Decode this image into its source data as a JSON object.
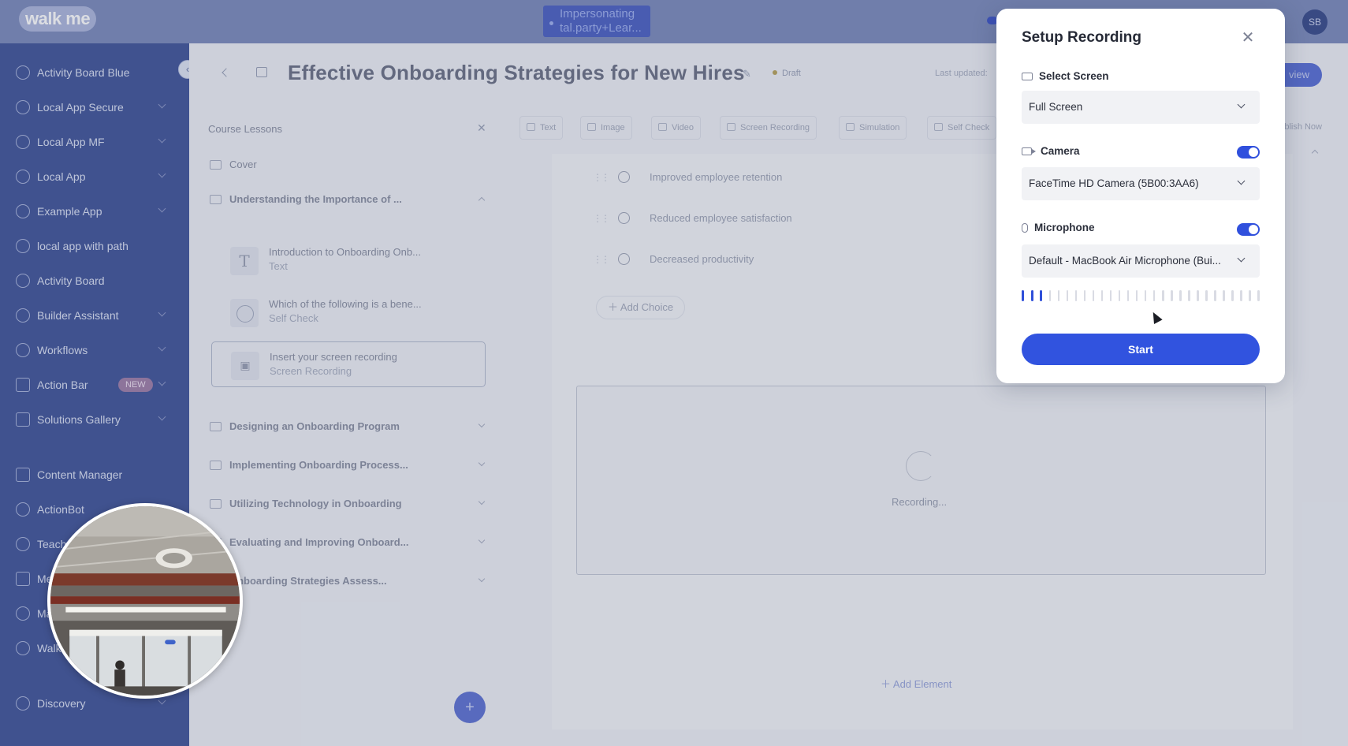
{
  "app": {
    "logo_text": "walk me",
    "impersonation": "Impersonating tal.party+Lear...",
    "user_initials": "SB"
  },
  "sidebar": {
    "items": [
      {
        "label": "Activity Board Blue",
        "chevron": false
      },
      {
        "label": "Local App Secure",
        "chevron": true
      },
      {
        "label": "Local App MF",
        "chevron": true
      },
      {
        "label": "Local App",
        "chevron": true
      },
      {
        "label": "Example App",
        "chevron": true
      },
      {
        "label": "local app with path",
        "chevron": false
      },
      {
        "label": "Activity Board",
        "chevron": false
      },
      {
        "label": "Builder Assistant",
        "chevron": true
      },
      {
        "label": "Workflows",
        "chevron": true
      },
      {
        "label": "Action Bar",
        "chevron": true,
        "badge": "NEW"
      },
      {
        "label": "Solutions Gallery",
        "chevron": true
      },
      {
        "label": "Content Manager",
        "chevron": false
      },
      {
        "label": "ActionBot",
        "chevron": false
      },
      {
        "label": "Teach",
        "chevron": false
      },
      {
        "label": "Me",
        "chevron": false
      },
      {
        "label": "Ma",
        "chevron": false
      },
      {
        "label": "Walk",
        "chevron": false
      },
      {
        "label": "Discovery",
        "chevron": true
      }
    ]
  },
  "header": {
    "title": "Effective Onboarding Strategies for New Hires",
    "status": "Draft",
    "last_updated": "Last updated:",
    "preview_label": "view"
  },
  "lessons": {
    "panel_title": "Course Lessons",
    "cover": "Cover",
    "sections": [
      "Understanding the Importance of ...",
      "Designing an Onboarding Program",
      "Implementing Onboarding Process...",
      "Utilizing Technology in Onboarding",
      "Evaluating and Improving Onboard...",
      "Onboarding Strategies Assess..."
    ],
    "sub_items": [
      {
        "title": "Introduction to Onboarding Onb...",
        "type": "Text"
      },
      {
        "title": "Which of the following is a bene...",
        "type": "Self Check"
      },
      {
        "title": "Insert your screen recording",
        "type": "Screen Recording"
      }
    ]
  },
  "toolbar": {
    "tools": [
      "Text",
      "Image",
      "Video",
      "Screen Recording",
      "Simulation",
      "Self Check"
    ],
    "publish_label": "Publish Now"
  },
  "content": {
    "choices": [
      "Improved employee retention",
      "Reduced employee satisfaction",
      "Decreased productivity"
    ],
    "add_choice": "Add Choice",
    "recording_status": "Recording...",
    "add_element": "Add Element"
  },
  "modal": {
    "title": "Setup Recording",
    "screen_label": "Select Screen",
    "screen_value": "Full Screen",
    "camera_label": "Camera",
    "camera_enabled": true,
    "camera_value": "FaceTime HD Camera (5B00:3AA6)",
    "mic_label": "Microphone",
    "mic_enabled": true,
    "mic_value": "Default - MacBook Air Microphone (Bui...",
    "mic_level_active_bars": 3,
    "mic_level_total_bars": 28,
    "start_label": "Start"
  },
  "colors": {
    "accent": "#3153df",
    "sidebar_bg": "#43569a",
    "topbar_bg": "#7d8cbc"
  }
}
